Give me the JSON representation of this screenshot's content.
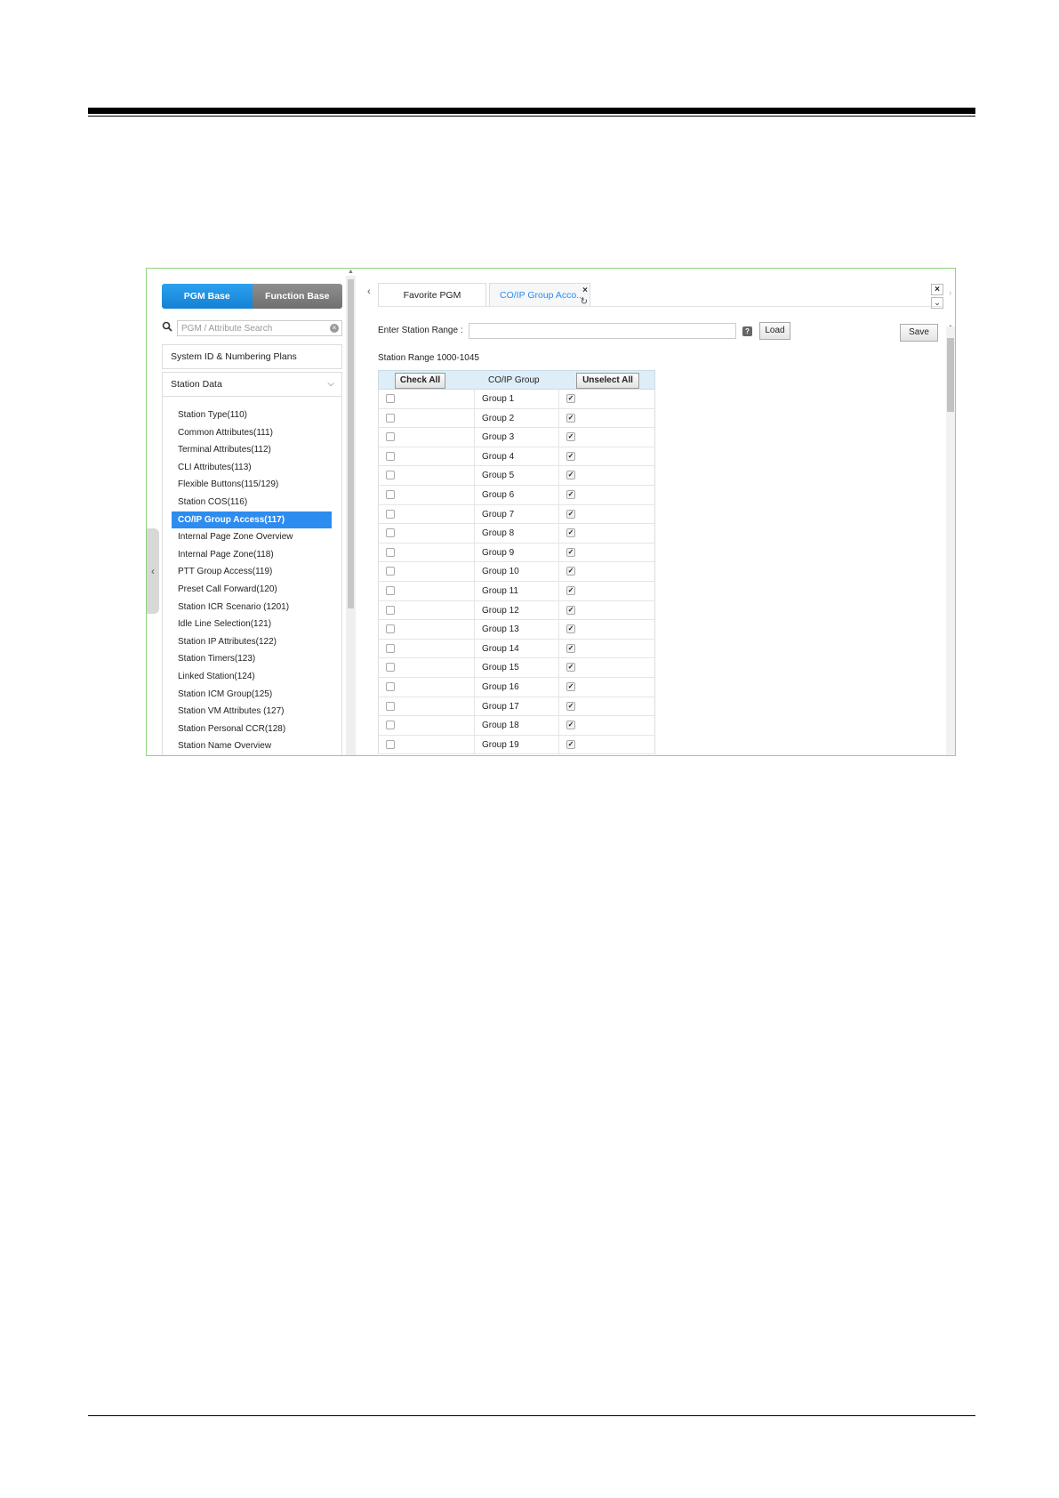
{
  "left": {
    "segments": [
      "PGM Base",
      "Function Base"
    ],
    "search_placeholder": "PGM / Attribute Search",
    "accordion": [
      {
        "label": "System ID & Numbering Plans"
      },
      {
        "label": "Station Data"
      }
    ],
    "menu": [
      "Station Type(110)",
      "Common Attributes(111)",
      "Terminal Attributes(112)",
      "CLI Attributes(113)",
      "Flexible Buttons(115/129)",
      "Station COS(116)",
      "CO/IP Group Access(117)",
      "Internal Page Zone Overview",
      "Internal Page Zone(118)",
      "PTT Group Access(119)",
      "Preset Call Forward(120)",
      "Station ICR Scenario (1201)",
      "Idle Line Selection(121)",
      "Station IP Attributes(122)",
      "Station Timers(123)",
      "Linked Station(124)",
      "Station ICM Group(125)",
      "Station VM Attributes (127)",
      "Station Personal CCR(128)",
      "Station Name Overview"
    ],
    "active_index": 6
  },
  "tabs": {
    "favorite": "Favorite PGM",
    "active": "CO/IP Group Acco..."
  },
  "form": {
    "range_label": "Enter Station Range :",
    "range_value": "",
    "load_label": "Load",
    "save_label": "Save",
    "range_text": "Station Range 1000-1045"
  },
  "grid": {
    "check_all": "Check All",
    "header_group": "CO/IP Group",
    "unselect_all": "Unselect All",
    "rows": [
      {
        "group": "Group 1",
        "selected": false,
        "checked": true
      },
      {
        "group": "Group 2",
        "selected": false,
        "checked": true
      },
      {
        "group": "Group 3",
        "selected": false,
        "checked": true
      },
      {
        "group": "Group 4",
        "selected": false,
        "checked": true
      },
      {
        "group": "Group 5",
        "selected": false,
        "checked": true
      },
      {
        "group": "Group 6",
        "selected": false,
        "checked": true
      },
      {
        "group": "Group 7",
        "selected": false,
        "checked": true
      },
      {
        "group": "Group 8",
        "selected": false,
        "checked": true
      },
      {
        "group": "Group 9",
        "selected": false,
        "checked": true
      },
      {
        "group": "Group 10",
        "selected": false,
        "checked": true
      },
      {
        "group": "Group 11",
        "selected": false,
        "checked": true
      },
      {
        "group": "Group 12",
        "selected": false,
        "checked": true
      },
      {
        "group": "Group 13",
        "selected": false,
        "checked": true
      },
      {
        "group": "Group 14",
        "selected": false,
        "checked": true
      },
      {
        "group": "Group 15",
        "selected": false,
        "checked": true
      },
      {
        "group": "Group 16",
        "selected": false,
        "checked": true
      },
      {
        "group": "Group 17",
        "selected": false,
        "checked": true
      },
      {
        "group": "Group 18",
        "selected": false,
        "checked": true
      },
      {
        "group": "Group 19",
        "selected": false,
        "checked": true
      }
    ]
  },
  "icons": {
    "search": "search-icon",
    "clear": "clear-icon",
    "help": "help-icon",
    "close": "close-icon",
    "refresh": "refresh-icon"
  },
  "colors": {
    "accent": "#2d8cf0",
    "frame_border": "#8fd37f",
    "grid_header": "#ddeef8"
  }
}
